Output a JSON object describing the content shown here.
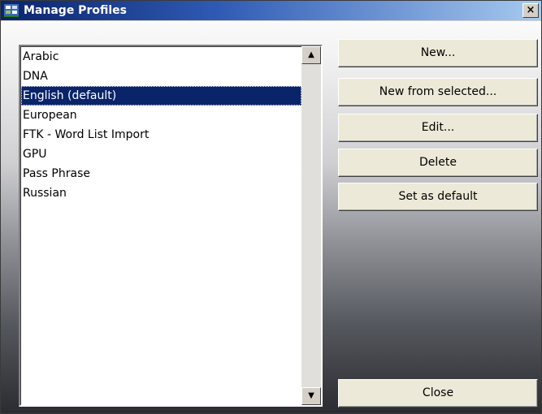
{
  "window": {
    "title": "Manage Profiles",
    "close_label": "×"
  },
  "profiles": {
    "items": [
      {
        "label": "Arabic"
      },
      {
        "label": "DNA"
      },
      {
        "label": "English (default)"
      },
      {
        "label": "European"
      },
      {
        "label": "FTK - Word List Import"
      },
      {
        "label": "GPU"
      },
      {
        "label": "Pass Phrase"
      },
      {
        "label": "Russian"
      }
    ],
    "selected": "English (default)"
  },
  "buttons": {
    "new": "New...",
    "new_from_selected": "New from selected...",
    "edit": "Edit...",
    "delete": "Delete",
    "set_default": "Set as default",
    "close": "Close"
  },
  "scrollbar": {
    "up_glyph": "▲",
    "down_glyph": "▼"
  },
  "colors": {
    "selection": "#0a246a",
    "titlebar_start": "#0a246a",
    "titlebar_end": "#a6caf0"
  }
}
